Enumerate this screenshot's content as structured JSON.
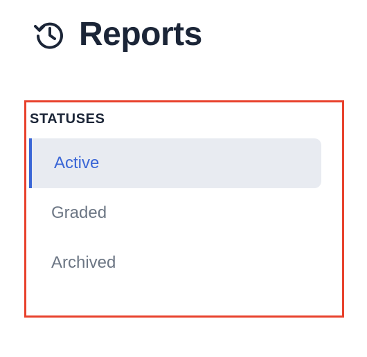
{
  "header": {
    "icon": "history-icon",
    "title": "Reports"
  },
  "statuses": {
    "heading": "STATUSES",
    "items": [
      {
        "label": "Active",
        "selected": true
      },
      {
        "label": "Graded",
        "selected": false
      },
      {
        "label": "Archived",
        "selected": false
      }
    ]
  },
  "colors": {
    "accent": "#3a66d6",
    "title": "#1b2537",
    "muted_text": "#6c7684",
    "selected_bg": "#e8ebf1",
    "highlight_border": "#e8412c"
  }
}
